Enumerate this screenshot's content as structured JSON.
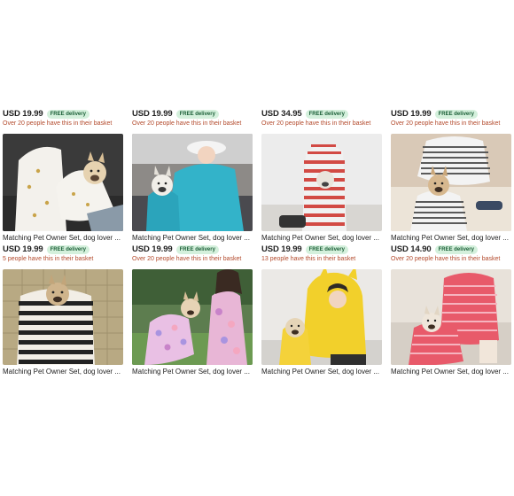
{
  "rows": [
    {
      "items": [
        {
          "price": "USD 19.99",
          "badge": "FREE delivery",
          "basket": "Over 20 people have this in their basket"
        },
        {
          "price": "USD 19.99",
          "badge": "FREE delivery",
          "basket": "Over 20 people have this in their basket"
        },
        {
          "price": "USD 34.95",
          "badge": "FREE delivery",
          "basket": "Over 20 people have this in their basket"
        },
        {
          "price": "USD 19.99",
          "badge": "FREE delivery",
          "basket": "Over 20 people have this in their basket"
        }
      ]
    },
    {
      "items": [
        {
          "title": "Matching Pet Owner Set, dog lover ...",
          "price": "USD 19.99",
          "badge": "FREE delivery",
          "basket": "5 people have this in their basket",
          "image": "white-sweater-dog-photo"
        },
        {
          "title": "Matching Pet Owner Set, dog lover ...",
          "price": "USD 19.99",
          "badge": "FREE delivery",
          "basket": "Over 20 people have this in their basket",
          "image": "teal-hoodie-dog-photo"
        },
        {
          "title": "Matching Pet Owner Set, dog lover ...",
          "price": "USD 19.99",
          "badge": "FREE delivery",
          "basket": "13 people have this in their basket",
          "image": "striped-hoodie-dog-photo"
        },
        {
          "title": "Matching Pet Owner Set, dog lover ...",
          "price": "USD 14.90",
          "badge": "FREE delivery",
          "basket": "Over 20 people have this in their basket",
          "image": "striped-tshirt-dog-photo"
        }
      ]
    },
    {
      "items": [
        {
          "title": "Matching Pet Owner Set, dog lover ...",
          "image": "black-striped-sweater-dog-photo"
        },
        {
          "title": "Matching Pet Owner Set, dog lover ...",
          "image": "floral-dress-dog-photo"
        },
        {
          "title": "Matching Pet Owner Set, dog lover ...",
          "image": "yellow-hoodie-dog-photo"
        },
        {
          "title": "Matching Pet Owner Set, dog lover ...",
          "image": "pink-striped-dress-dog-photo"
        }
      ]
    }
  ],
  "colors": {
    "badge_bg": "#d4f0dc",
    "badge_text": "#1a5e36",
    "basket_text": "#b34a2c"
  }
}
